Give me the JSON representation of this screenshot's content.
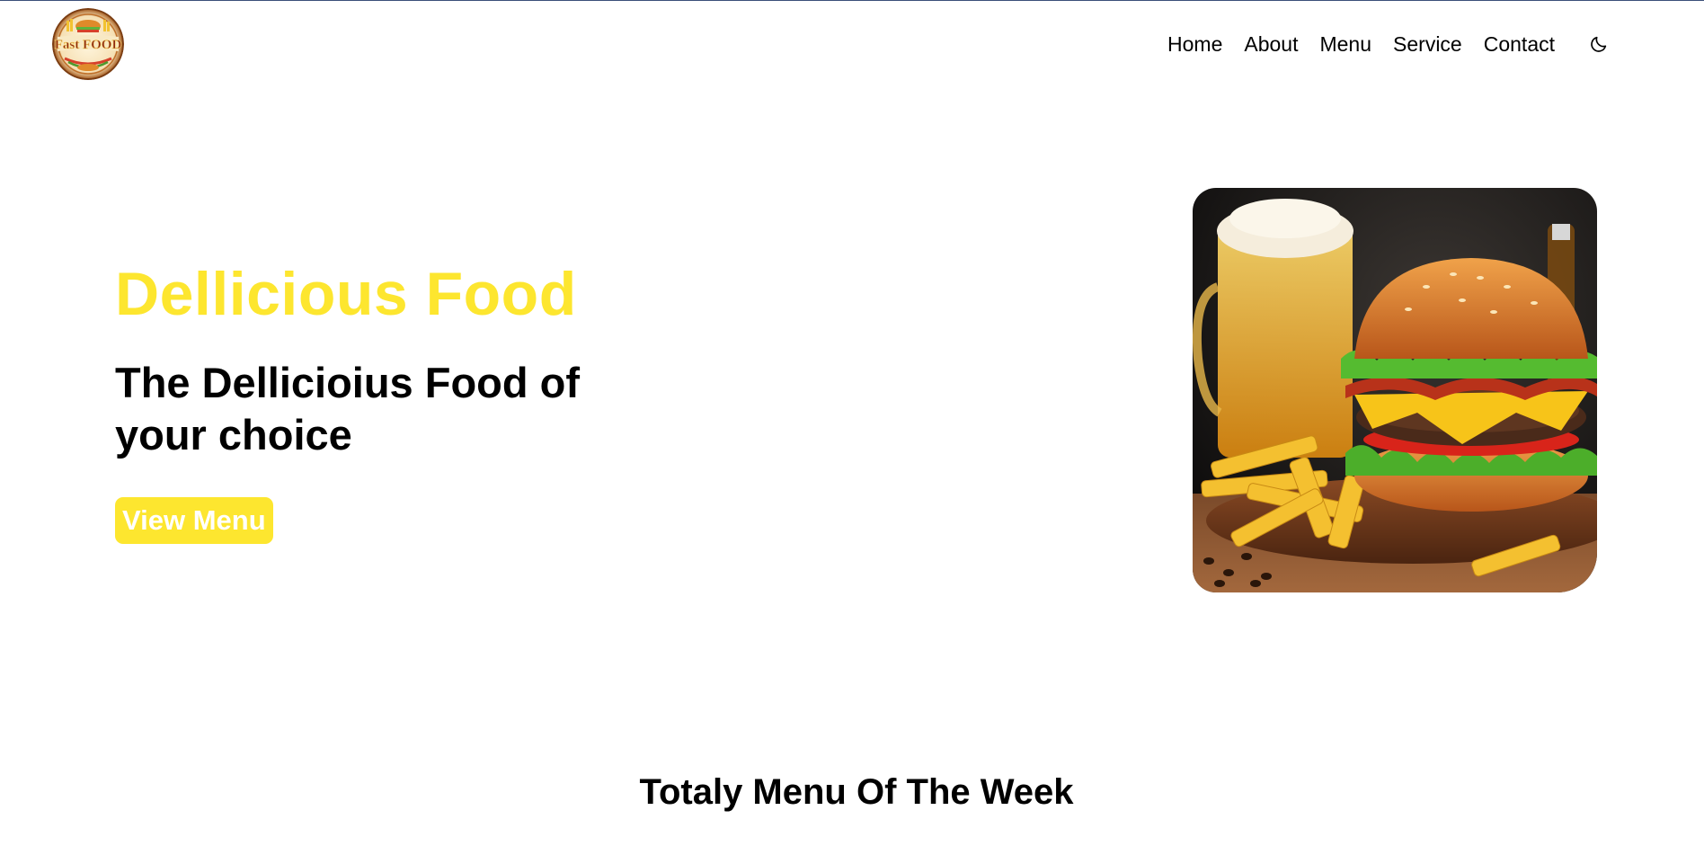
{
  "brand": {
    "logo_text": "Fast FOOD",
    "logo_alt": "Fast Food logo"
  },
  "nav": {
    "items": [
      {
        "label": "Home"
      },
      {
        "label": "About"
      },
      {
        "label": "Menu"
      },
      {
        "label": "Service"
      },
      {
        "label": "Contact"
      }
    ],
    "theme_toggle_icon": "moon-icon"
  },
  "hero": {
    "title": "Dellicious Food",
    "subtitle": "The Dellicioius Food of your choice",
    "button_label": "View Menu",
    "image_icon": "burger-beer-fries-photo"
  },
  "section": {
    "title": "Totaly Menu Of The Week"
  },
  "colors": {
    "accent": "#fde62f",
    "text": "#000000",
    "background": "#ffffff",
    "top_border": "#3b4f7a"
  }
}
